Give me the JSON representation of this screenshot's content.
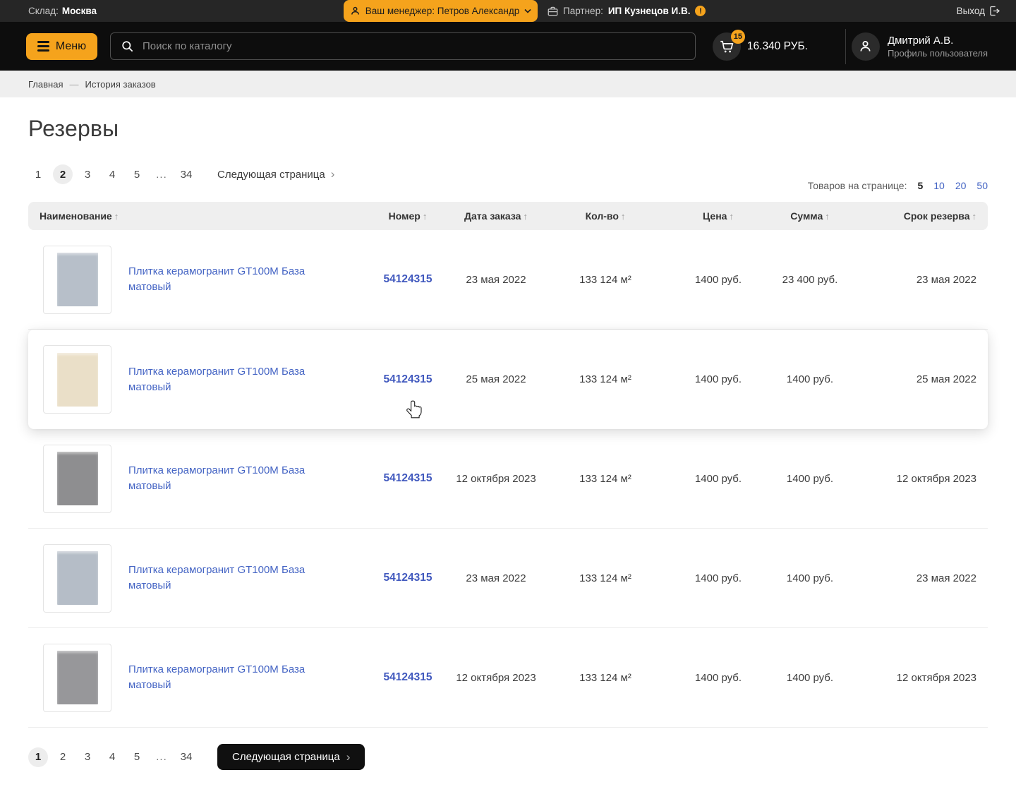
{
  "colors": {
    "accent_orange": "#F5A31C",
    "topbar_bg": "#262626",
    "header_bg": "#0D0D0D",
    "breadcrumb_bg": "#EFEFEF",
    "link_blue": "#4464C4",
    "number_blue": "#4159BE"
  },
  "topbar": {
    "warehouse_label": "Склад:",
    "warehouse_value": "Москва",
    "manager_label": "Ваш менеджер: Петров Александр",
    "partner_label": "Партнер:",
    "partner_value": "ИП Кузнецов И.В.",
    "partner_alert": "!",
    "logout_label": "Выход"
  },
  "header": {
    "menu_label": "Меню",
    "search_placeholder": "Поиск по каталогу",
    "cart_count": "15",
    "cart_total": "16.340 РУБ.",
    "user_name": "Дмитрий А.В.",
    "user_role": "Профиль пользователя"
  },
  "breadcrumb": {
    "home": "Главная",
    "separator": "—",
    "current": "История заказов"
  },
  "page_title": "Резервы",
  "pagination_top": {
    "pages": [
      "1",
      "2",
      "3",
      "4",
      "5",
      "...",
      "34"
    ],
    "active": "2",
    "next_label": "Следующая страница",
    "chevron": "›"
  },
  "per_page": {
    "label": "Товаров на странице:",
    "options": [
      "5",
      "10",
      "20",
      "50"
    ],
    "active": "5"
  },
  "table": {
    "sort_arrow": "↑",
    "headers": {
      "name": "Наименование",
      "number": "Номер",
      "order_date": "Дата заказа",
      "quantity": "Кол-во",
      "price": "Цена",
      "total": "Сумма",
      "reserve_until": "Срок резерва"
    },
    "rows": [
      {
        "name": "Плитка керамогранит GT100M База матовый",
        "number": "54124315",
        "order_date": "23 мая 2022",
        "quantity": "133 124 м²",
        "price": "1400 руб.",
        "total": "23 400 руб.",
        "reserve_until": "23 мая 2022",
        "tile_color": "#B7BFC9",
        "hovered": false
      },
      {
        "name": "Плитка керамогранит GT100M База матовый",
        "number": "54124315",
        "order_date": "25 мая 2022",
        "quantity": "133 124 м²",
        "price": "1400 руб.",
        "total": "1400 руб.",
        "reserve_until": "25 мая 2022",
        "tile_color": "#EADFC8",
        "hovered": true
      },
      {
        "name": "Плитка керамогранит GT100M База матовый",
        "number": "54124315",
        "order_date": "12 октября 2023",
        "quantity": "133 124 м²",
        "price": "1400 руб.",
        "total": "1400 руб.",
        "reserve_until": "12 октября 2023",
        "tile_color": "#8E8E90",
        "hovered": false
      },
      {
        "name": "Плитка керамогранит GT100M База матовый",
        "number": "54124315",
        "order_date": "23 мая 2022",
        "quantity": "133 124 м²",
        "price": "1400 руб.",
        "total": "1400 руб.",
        "reserve_until": "23 мая 2022",
        "tile_color": "#B5BDC7",
        "hovered": false
      },
      {
        "name": "Плитка керамогранит GT100M База матовый",
        "number": "54124315",
        "order_date": "12 октября 2023",
        "quantity": "133 124 м²",
        "price": "1400 руб.",
        "total": "1400 руб.",
        "reserve_until": "12 октября 2023",
        "tile_color": "#97979A",
        "hovered": false
      }
    ]
  },
  "pagination_bottom": {
    "pages": [
      "1",
      "2",
      "3",
      "4",
      "5",
      "...",
      "34"
    ],
    "active": "1",
    "next_label": "Следующая страница",
    "chevron": "›"
  }
}
